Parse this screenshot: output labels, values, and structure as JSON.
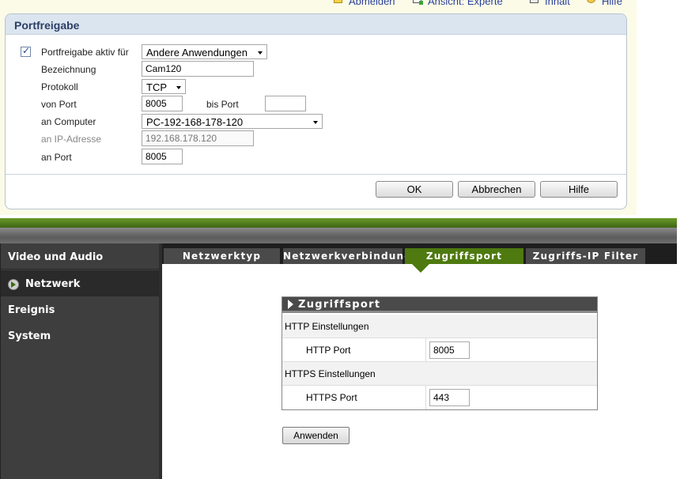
{
  "top_nav": {
    "logout": "Abmelden",
    "view_label": "Ansicht:",
    "view_value": "Experte",
    "content": "Inhalt",
    "help": "Hilfe"
  },
  "portfreigabe": {
    "title": "Portfreigabe",
    "active_checked": true,
    "active_label": "Portfreigabe aktiv für",
    "active_value": "Andere Anwendungen",
    "name_label": "Bezeichnung",
    "name_value": "Cam120",
    "protocol_label": "Protokoll",
    "protocol_value": "TCP",
    "from_port_label": "von Port",
    "from_port_value": "8005",
    "to_port_label": "bis Port",
    "to_port_value": "",
    "computer_label": "an Computer",
    "computer_value": "PC-192-168-178-120",
    "ip_label": "an IP-Adresse",
    "ip_value": "192.168.178.120",
    "to_port2_label": "an Port",
    "to_port2_value": "8005",
    "ok": "OK",
    "cancel": "Abbrechen",
    "help": "Hilfe"
  },
  "camera": {
    "sidebar": [
      {
        "label": "Video und Audio",
        "active": false
      },
      {
        "label": "Netzwerk",
        "active": true
      },
      {
        "label": "Ereignis",
        "active": false
      },
      {
        "label": "System",
        "active": false
      }
    ],
    "tabs": [
      {
        "label": "Netzwerktyp",
        "active": false
      },
      {
        "label": "Netzwerkverbindung",
        "active": false
      },
      {
        "label": "Zugriffsport",
        "active": true
      },
      {
        "label": "Zugriffs-IP Filter",
        "active": false
      }
    ],
    "box_title": "Zugriffsport",
    "http_section": "HTTP Einstellungen",
    "http_port_label": "HTTP Port",
    "http_port_value": "8005",
    "https_section": "HTTPS Einstellungen",
    "https_port_label": "HTTPS Port",
    "https_port_value": "443",
    "apply": "Anwenden"
  },
  "colors": {
    "accent_green": "#4e7a10",
    "panel_header": "#dbe5ef",
    "sidebar_bg": "#3e3e3e"
  }
}
